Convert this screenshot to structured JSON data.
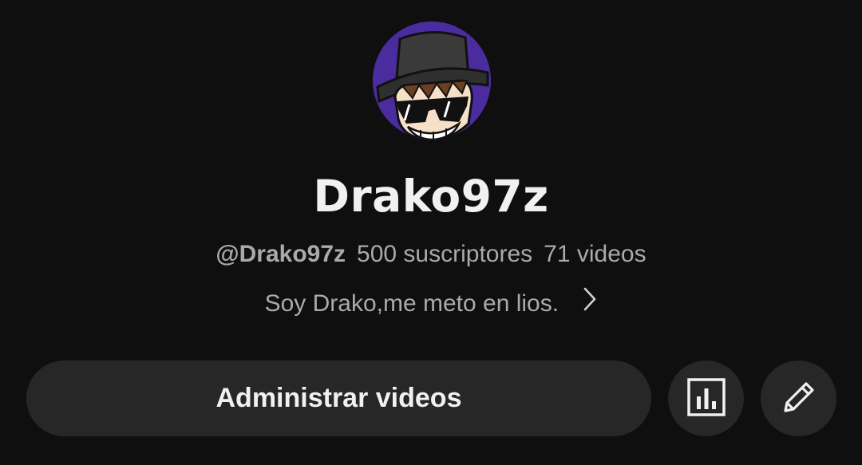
{
  "channel": {
    "name": "Drako97z",
    "handle": "@Drako97z",
    "subscribers": "500 suscriptores",
    "videos": "71 videos",
    "description": "Soy Drako,me meto en lios."
  },
  "actions": {
    "manage_videos_label": "Administrar videos",
    "analytics_icon": "bar-chart-icon",
    "edit_icon": "pencil-icon"
  },
  "colors": {
    "background": "#0f0f0f",
    "button_bg": "#272727",
    "primary_text": "#f1f1f1",
    "secondary_text": "#aaaaaa",
    "avatar_bg": "#4a2a9a"
  }
}
